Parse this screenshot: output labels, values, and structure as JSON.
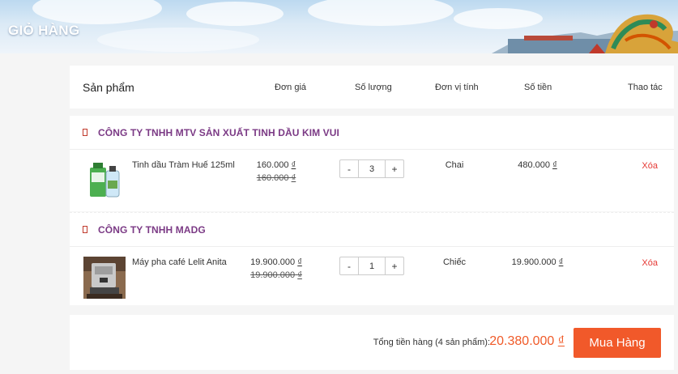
{
  "page": {
    "title": "GIỎ HÀNG"
  },
  "table_header": {
    "product": "Sản phẩm",
    "unit_price": "Đơn giá",
    "quantity": "Số lượng",
    "unit": "Đơn vị tính",
    "amount": "Số tiền",
    "actions": "Thao tác"
  },
  "groups": [
    {
      "shop": "CÔNG TY TNHH MTV SẢN XUẤT TINH DẦU KIM VUI",
      "item": {
        "name": "Tinh dầu Tràm Huế 125ml",
        "price": "160.000",
        "old_price": "160.000",
        "quantity": "3",
        "unit": "Chai",
        "amount": "480.000",
        "delete": "Xóa"
      }
    },
    {
      "shop": "CÔNG TY TNHH MADG",
      "item": {
        "name": "Máy pha café Lelit Anita",
        "price": "19.900.000",
        "old_price": "19.900.000",
        "quantity": "1",
        "unit": "Chiếc",
        "amount": "19.900.000",
        "delete": "Xóa"
      }
    }
  ],
  "currency": "₫",
  "qty_minus": "-",
  "qty_plus": "+",
  "footer": {
    "total_label": "Tổng tiền hàng (4 sản phẩm):",
    "total_value": "20.380.000",
    "buy_button": "Mua Hàng"
  },
  "icons": {
    "shop_checkbox": "checkbox-icon"
  },
  "colors": {
    "accent": "#f1592a",
    "shop_name": "#7b3a85",
    "delete": "#e53935"
  }
}
